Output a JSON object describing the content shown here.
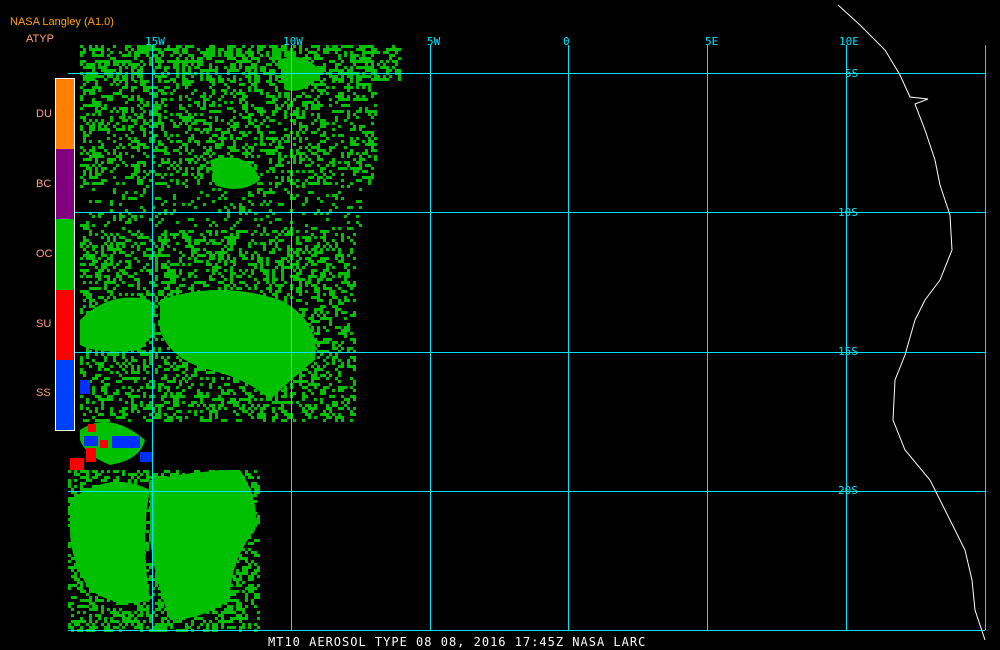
{
  "header": {
    "title": "NASA Langley (A1.0)",
    "parameter": "ATYP"
  },
  "longitude_labels": [
    "15W",
    "10W",
    "5W",
    "0",
    "5E",
    "10E"
  ],
  "latitude_labels": [
    "5S",
    "10S",
    "15S",
    "20S"
  ],
  "legend": [
    {
      "label": "DU",
      "color": "#ff8000"
    },
    {
      "label": "BC",
      "color": "#800080"
    },
    {
      "label": "OC",
      "color": "#00c000"
    },
    {
      "label": "SU",
      "color": "#ff0000"
    },
    {
      "label": "SS",
      "color": "#0040ff"
    }
  ],
  "footer": "MT10  AEROSOL TYPE  08 08, 2016 17:45Z  NASA LARC",
  "colors": {
    "grid": "#00e5ff",
    "coast": "#ffffff",
    "aerosol": "#00c000"
  }
}
